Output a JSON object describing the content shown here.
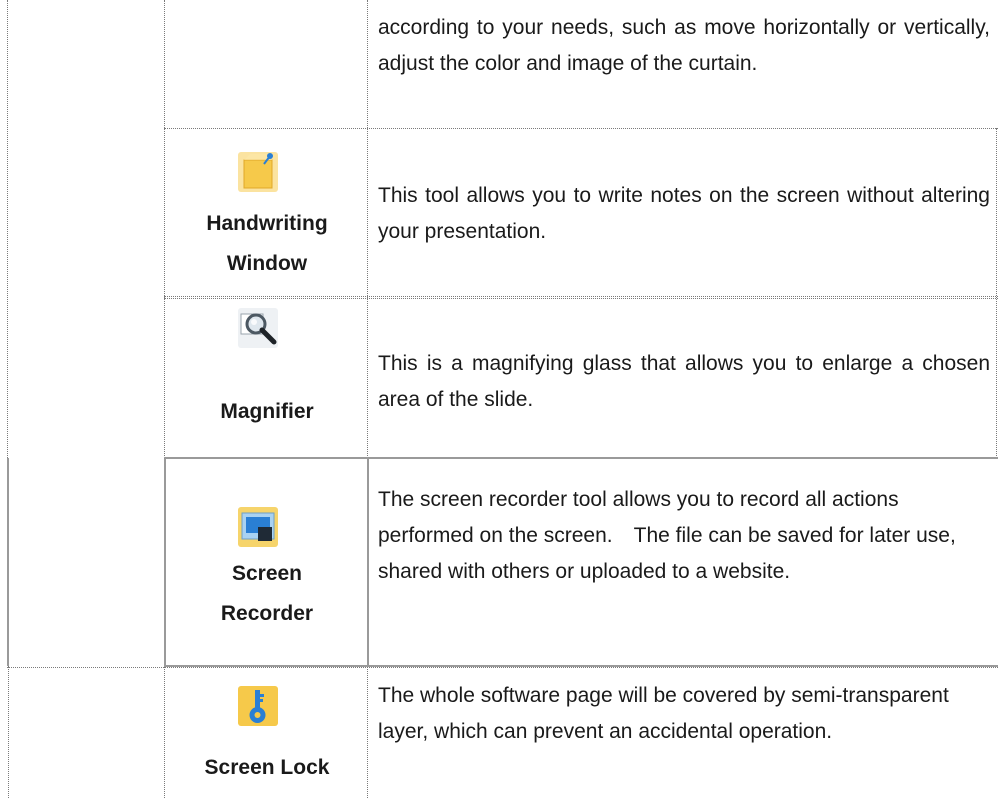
{
  "intro": {
    "text": "according to your needs, such as move horizontally or vertically, adjust the color and image of the curtain."
  },
  "tools": [
    {
      "name_lines": [
        "Handwriting",
        "Window"
      ],
      "icon": "sticky-note-pin-icon",
      "description": "This tool allows you to write notes on the screen without altering your presentation."
    },
    {
      "name_lines": [
        "Magnifier"
      ],
      "icon": "magnifier-icon",
      "description": "This is a magnifying glass that allows you to enlarge a chosen area of the slide."
    },
    {
      "name_lines": [
        "Screen",
        "Recorder"
      ],
      "icon": "screen-recorder-icon",
      "description": "The screen recorder tool allows you to record all actions performed on the screen.　The file can be saved for later use, shared with others or uploaded to a website."
    },
    {
      "name_lines": [
        "Screen Lock"
      ],
      "icon": "key-lock-icon",
      "description": "The whole software page will be covered by semi-transparent layer, which can prevent an accidental operation."
    }
  ],
  "colors": {
    "icon_yellow": "#f6c94a",
    "icon_blue": "#2a7fd4",
    "grid_line": "#7a7a7a"
  }
}
